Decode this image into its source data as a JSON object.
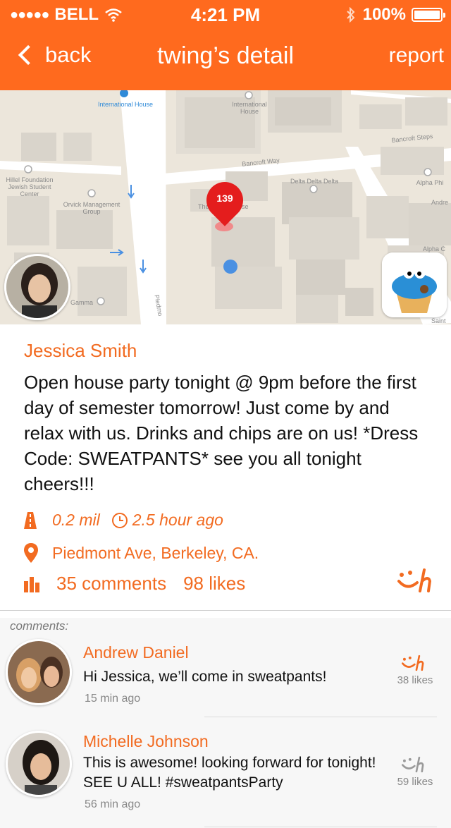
{
  "status_bar": {
    "carrier": "BELL",
    "time": "4:21 PM",
    "battery": "100%"
  },
  "nav": {
    "back_label": "back",
    "title": "twing’s detail",
    "report_label": "report"
  },
  "map": {
    "labels": {
      "international_house_1": "International House",
      "international_house_2": "International House",
      "bancroft_steps": "Bancroft Steps",
      "bancroft_way": "Bancroft Way",
      "hillel": "Hillel Foundation Jewish Student Center",
      "delta_delta_delta": "Delta Delta Delta",
      "alpha_phi": "Alpha Phi",
      "orvick": "Orvick Management Group",
      "andre": "Andre",
      "alpha_c": "Alpha C",
      "gamma": "Gamma",
      "piedmont": "Piedmo",
      "saint": "Saint",
      "the_house": "The",
      "house_suffix": "se"
    },
    "pin_count": "139"
  },
  "post": {
    "author": "Jessica Smith",
    "text": "Open house party tonight @ 9pm before the first day of semester tomorrow! Just come by and relax with us. Drinks and chips are on us! *Dress Code: SWEATPANTS* see you all tonight cheers!!!",
    "distance": "0.2 mil",
    "time_ago": "2.5 hour ago",
    "location": "Piedmont Ave, Berkeley, CA.",
    "comments_count": "35 comments",
    "likes_count": "98 likes"
  },
  "comments_section": {
    "title": "comments:",
    "items": [
      {
        "name": "Andrew Daniel",
        "text": "Hi Jessica, we’ll come in sweatpants!",
        "time": "15 min ago",
        "likes": "38 likes"
      },
      {
        "name": "Michelle Johnson",
        "text": "This is awesome! looking forward for tonight! SEE U ALL! #sweatpantsParty",
        "time": "56 min ago",
        "likes": "59 likes"
      }
    ]
  },
  "colors": {
    "brand_orange": "#ff6a1e",
    "text_orange": "#f26b21",
    "pin_red": "#e41d1d",
    "location_blue": "#4a90e2"
  },
  "icons": {
    "back": "chevron-left-icon",
    "wifi": "wifi-icon",
    "bluetooth": "bluetooth-icon",
    "battery": "battery-icon",
    "distance": "road-icon",
    "time": "clock-icon",
    "location": "map-pin-icon",
    "stats": "bar-chart-icon",
    "like": "smile-logo-icon"
  }
}
